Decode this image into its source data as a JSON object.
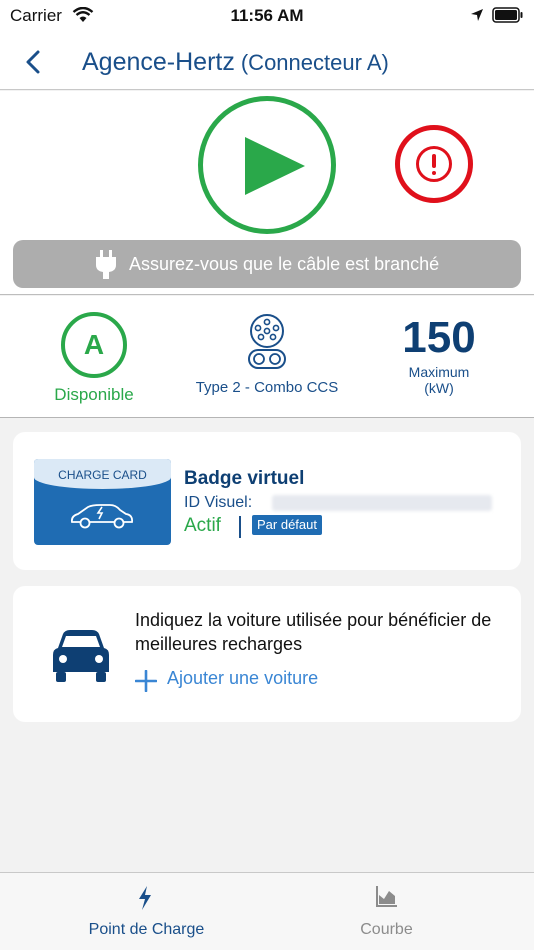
{
  "status_bar": {
    "carrier": "Carrier",
    "time": "11:56 AM"
  },
  "header": {
    "title": "Agence-Hertz",
    "subtitle": "(Connecteur A)"
  },
  "controls": {
    "start_icon": "play-icon",
    "stop_icon": "alert-icon",
    "start_color": "#2aa84a",
    "stop_color": "#e0101b"
  },
  "banner": {
    "message": "Assurez-vous que le câble est branché"
  },
  "connector": {
    "letter": "A",
    "status": "Disponible",
    "type_label": "Type 2 - Combo CCS",
    "power": "150",
    "power_label": "Maximum",
    "power_unit": "(kW)"
  },
  "badge": {
    "card_label": "CHARGE CARD",
    "title": "Badge virtuel",
    "id_label": "ID Visuel:",
    "status": "Actif",
    "tag": "Par défaut"
  },
  "car": {
    "prompt": "Indiquez la voiture utilisée pour bénéficier de meilleures recharges",
    "add_label": "Ajouter une voiture"
  },
  "tabs": [
    {
      "label": "Point de Charge",
      "icon": "bolt-icon",
      "active": true
    },
    {
      "label": "Courbe",
      "icon": "area-chart-icon",
      "active": false
    }
  ]
}
